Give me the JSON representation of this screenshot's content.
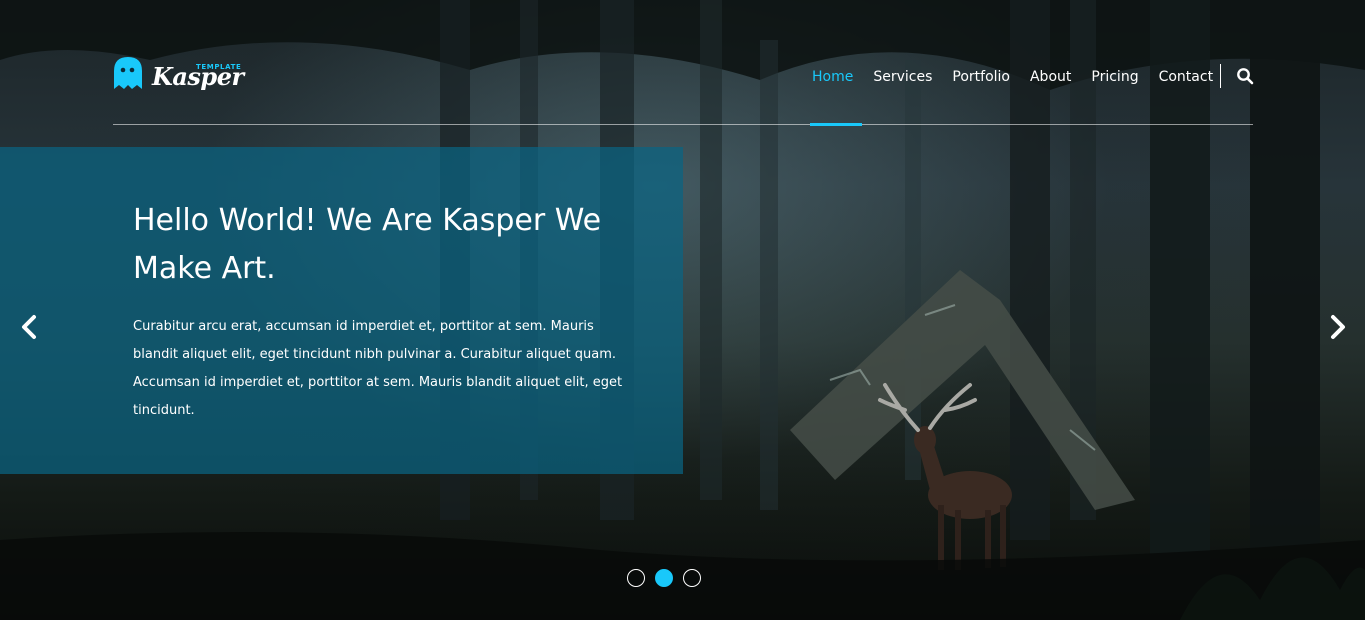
{
  "brand": {
    "name": "Kasper",
    "tagline": "TEMPLATE",
    "accent_color": "#19c8fa"
  },
  "nav": {
    "items": [
      {
        "label": "Home",
        "active": true
      },
      {
        "label": "Services",
        "active": false
      },
      {
        "label": "Portfolio",
        "active": false
      },
      {
        "label": "About",
        "active": false
      },
      {
        "label": "Pricing",
        "active": false
      },
      {
        "label": "Contact",
        "active": false
      }
    ],
    "search_icon": "search-icon"
  },
  "slide": {
    "title": "Hello World! We Are Kasper We Make Art.",
    "text": "Curabitur arcu erat, accumsan id imperdiet et, porttitor at sem. Mauris blandit aliquet elit, eget tincidunt nibh pulvinar a. Curabitur aliquet quam. Accumsan id imperdiet et, porttitor at sem. Mauris blandit aliquet elit, eget tincidunt.",
    "panel_color": "#0a6482"
  },
  "slider": {
    "prev_icon": "chevron-left-icon",
    "next_icon": "chevron-right-icon",
    "dots": [
      {
        "active": false
      },
      {
        "active": true
      },
      {
        "active": false
      }
    ]
  }
}
